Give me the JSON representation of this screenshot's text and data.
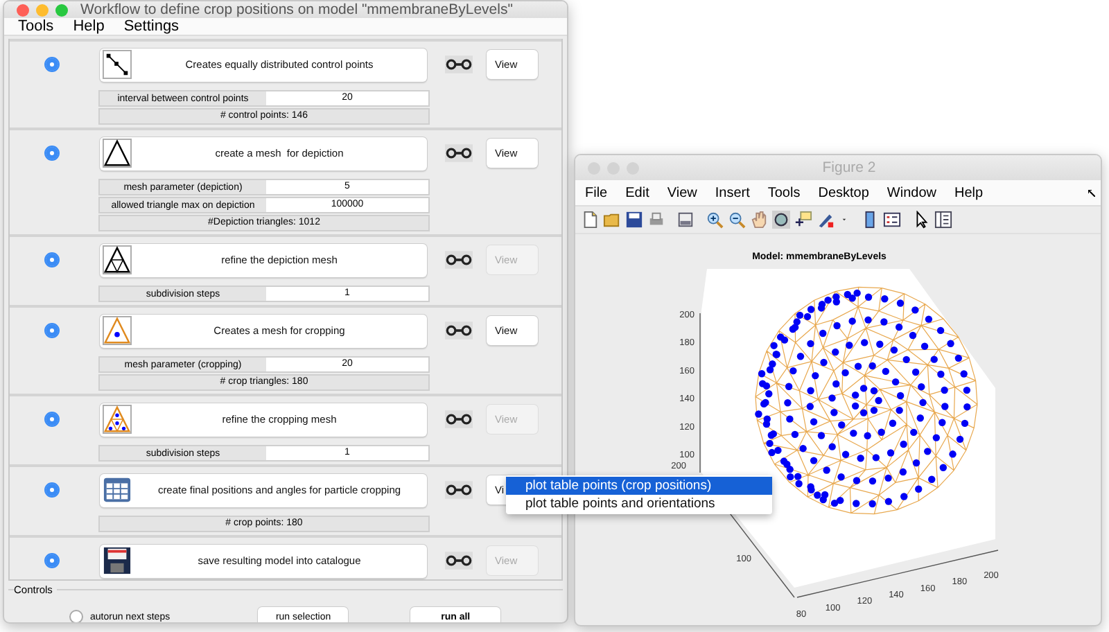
{
  "workflow_window": {
    "title": "Workflow to define crop positions on model \"mmembraneByLevels\"",
    "active": true,
    "menu": [
      "Tools",
      "Help",
      "Settings"
    ],
    "steps": [
      {
        "selected": true,
        "kind": "points",
        "label": "Creates equally distributed control points",
        "view": "View",
        "view_enabled": true,
        "params": [
          {
            "label": "interval between control points",
            "value": "20"
          }
        ],
        "info": "# control points: 146"
      },
      {
        "selected": true,
        "kind": "triangle",
        "label": "create a mesh  for depiction",
        "view": "View",
        "view_enabled": true,
        "params": [
          {
            "label": "mesh parameter (depiction)",
            "value": "5"
          },
          {
            "label": "allowed triangle max on depiction",
            "value": "100000"
          }
        ],
        "info": "#Depiction triangles: 1012"
      },
      {
        "selected": true,
        "kind": "refined-triangle",
        "label": "refine the depiction mesh",
        "view": "View",
        "view_enabled": false,
        "params": [
          {
            "label": "subdivision steps",
            "value": "1"
          }
        ]
      },
      {
        "selected": true,
        "kind": "crop-triangle",
        "label": "Creates a mesh for cropping",
        "view": "View",
        "view_enabled": true,
        "params": [
          {
            "label": "mesh parameter (cropping)",
            "value": "20"
          }
        ],
        "info": "# crop triangles: 180"
      },
      {
        "selected": true,
        "kind": "refined-crop-triangle",
        "label": "refine the cropping mesh",
        "view": "View",
        "view_enabled": false,
        "params": [
          {
            "label": "subdivision steps",
            "value": "1"
          }
        ]
      },
      {
        "selected": true,
        "kind": "table",
        "label": "create final positions and angles for particle cropping",
        "view": "Vi",
        "view_enabled": true,
        "info": "# crop points: 180"
      },
      {
        "selected": true,
        "kind": "floppy",
        "label": "save resulting model into catalogue",
        "view": "View",
        "view_enabled": false
      }
    ],
    "controls": {
      "title": "Controls",
      "autorun": {
        "label": "autorun next steps",
        "selected": false
      },
      "buttons": [
        {
          "label": "run selection",
          "bold": false
        },
        {
          "label": "run all",
          "bold": true
        }
      ]
    }
  },
  "figure_window": {
    "title": "Figure 2",
    "active": false,
    "menu": [
      "File",
      "Edit",
      "View",
      "Insert",
      "Tools",
      "Desktop",
      "Window",
      "Help"
    ],
    "plot": {
      "title": "Model: mmembraneByLevels",
      "vertical_ticks": [
        "200",
        "180",
        "160",
        "140",
        "120",
        "100"
      ],
      "depth_ticks": [
        "200",
        "100"
      ],
      "horizontal_ticks": [
        "80",
        "100",
        "120",
        "140",
        "160",
        "180",
        "200"
      ]
    }
  },
  "context_menu": {
    "items": [
      {
        "label": "plot table points (crop positions)",
        "selected": true
      },
      {
        "label": "plot table points and orientations",
        "selected": false
      }
    ]
  }
}
